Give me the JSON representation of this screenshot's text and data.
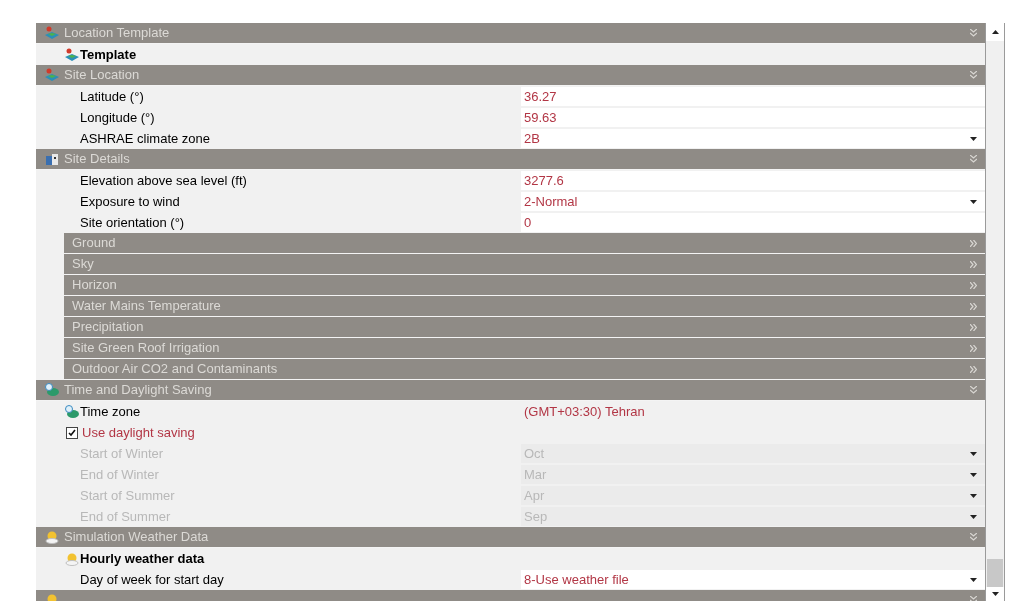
{
  "rows": [
    {
      "kind": "section",
      "title": "Location Template"
    },
    {
      "kind": "heading",
      "title": "Template"
    },
    {
      "kind": "section",
      "title": "Site Location"
    },
    {
      "kind": "property",
      "label": "Latitude (°)",
      "value": "36.27",
      "dropdown": false,
      "disabled": false
    },
    {
      "kind": "property",
      "label": "Longitude (°)",
      "value": "59.63",
      "dropdown": false,
      "disabled": false
    },
    {
      "kind": "property",
      "label": "ASHRAE climate zone",
      "value": "2B",
      "dropdown": true,
      "disabled": false
    },
    {
      "kind": "section",
      "title": "Site Details"
    },
    {
      "kind": "property",
      "label": "Elevation above sea level (ft)",
      "value": "3277.6",
      "dropdown": false,
      "disabled": false
    },
    {
      "kind": "property",
      "label": "Exposure to wind",
      "value": "2-Normal",
      "dropdown": true,
      "disabled": false
    },
    {
      "kind": "property",
      "label": "Site orientation (°)",
      "value": "0",
      "dropdown": false,
      "disabled": false
    },
    {
      "kind": "subsection",
      "title": "Ground"
    },
    {
      "kind": "subsection",
      "title": "Sky"
    },
    {
      "kind": "subsection",
      "title": "Horizon"
    },
    {
      "kind": "subsection",
      "title": "Water Mains Temperature"
    },
    {
      "kind": "subsection",
      "title": "Precipitation"
    },
    {
      "kind": "subsection",
      "title": "Site Green Roof Irrigation"
    },
    {
      "kind": "subsection",
      "title": "Outdoor Air CO2 and Contaminants"
    },
    {
      "kind": "section",
      "title": "Time and Daylight Saving"
    },
    {
      "kind": "link",
      "label": "Time zone",
      "value": "(GMT+03:30) Tehran"
    },
    {
      "kind": "checkbox",
      "label": "Use daylight saving",
      "checked": true
    },
    {
      "kind": "property",
      "label": "Start of Winter",
      "value": "Oct",
      "dropdown": true,
      "disabled": true
    },
    {
      "kind": "property",
      "label": "End of Winter",
      "value": "Mar",
      "dropdown": true,
      "disabled": true
    },
    {
      "kind": "property",
      "label": "Start of Summer",
      "value": "Apr",
      "dropdown": true,
      "disabled": true
    },
    {
      "kind": "property",
      "label": "End of Summer",
      "value": "Sep",
      "dropdown": true,
      "disabled": true
    },
    {
      "kind": "section",
      "title": "Simulation Weather Data"
    },
    {
      "kind": "heading",
      "title": "Hourly weather data"
    },
    {
      "kind": "property",
      "label": "Day of week for start day",
      "value": "8-Use weather file",
      "dropdown": true,
      "disabled": false
    },
    {
      "kind": "section"
    }
  ]
}
